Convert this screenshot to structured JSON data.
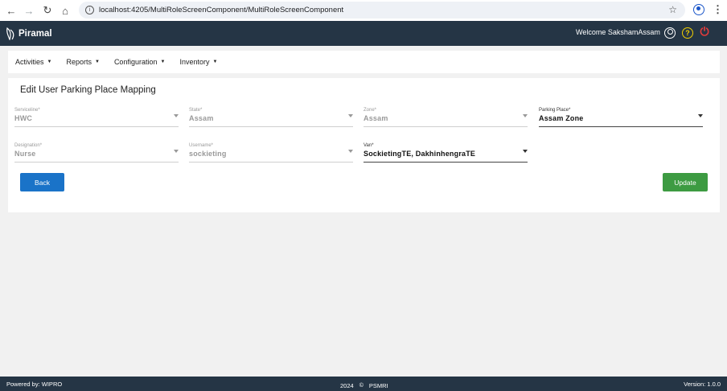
{
  "browser": {
    "url": "localhost:4205/MultiRoleScreenComponent/MultiRoleScreenComponent"
  },
  "header": {
    "brand": "Piramal",
    "welcome": "Welcome SakshamAssam"
  },
  "menu": {
    "items": [
      {
        "label": "Activities"
      },
      {
        "label": "Reports"
      },
      {
        "label": "Configuration"
      },
      {
        "label": "Inventory"
      }
    ]
  },
  "form": {
    "title": "Edit User Parking Place Mapping",
    "fields": [
      {
        "label": "Serviceline*",
        "value": "HWC"
      },
      {
        "label": "State*",
        "value": "Assam"
      },
      {
        "label": "Zone*",
        "value": "Assam"
      },
      {
        "label": "Parking Place*",
        "value": "Assam Zone"
      },
      {
        "label": "Designation*",
        "value": "Nurse"
      },
      {
        "label": "Username*",
        "value": "sockieting"
      },
      {
        "label": "Van*",
        "value": "SockietingTE, DakhinhengraTE"
      }
    ],
    "back_label": "Back",
    "update_label": "Update"
  },
  "footer": {
    "powered_by": "Powered by: WIPRO",
    "year": "2024",
    "copyright_symbol": "©",
    "org": "PSMRI",
    "version": "Version: 1.0.0"
  }
}
